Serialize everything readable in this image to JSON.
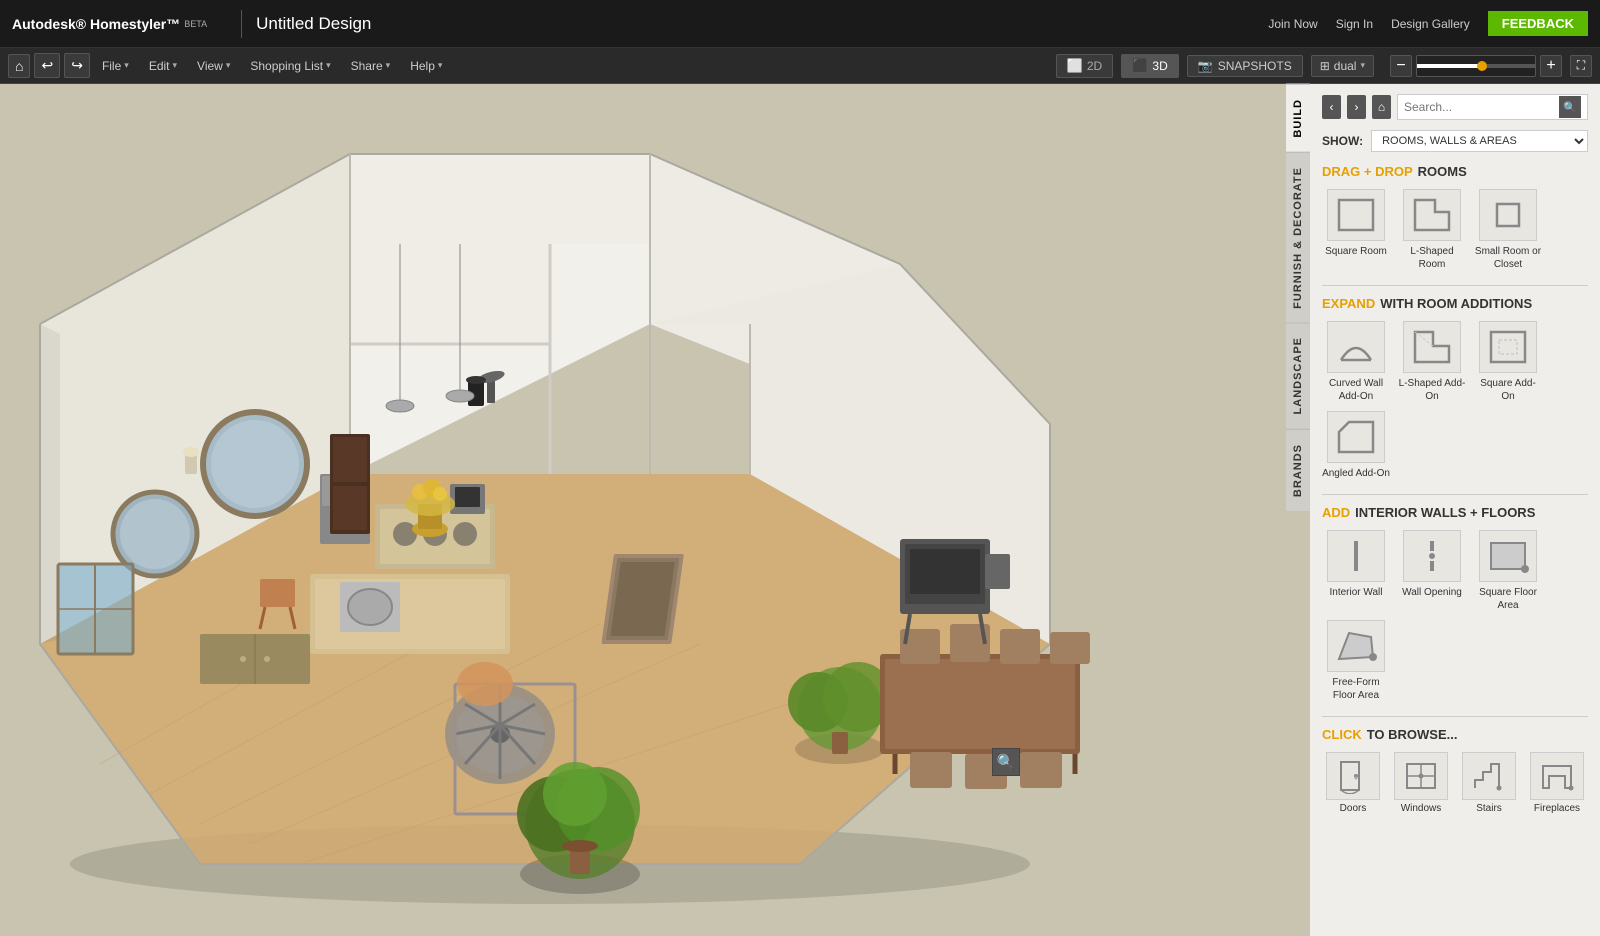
{
  "app": {
    "brand": "Autodesk® Homestyler™",
    "beta_label": "BETA",
    "title": "Untitled Design",
    "top_links": [
      "Join Now",
      "Sign In",
      "Design Gallery"
    ],
    "feedback_label": "FEEDBACK"
  },
  "menubar": {
    "file_label": "File",
    "edit_label": "Edit",
    "view_label": "View",
    "shopping_list_label": "Shopping List",
    "share_label": "Share",
    "help_label": "Help",
    "view_2d": "2D",
    "view_3d": "3D",
    "snapshots_label": "SNAPSHOTS",
    "dual_label": "dual",
    "zoom_level": "55"
  },
  "sidebar": {
    "nav_back": "‹",
    "nav_fwd": "›",
    "nav_home": "⌂",
    "search_placeholder": "Search...",
    "show_label": "SHOW:",
    "show_option": "ROOMS, WALLS & AREAS",
    "tabs": [
      "BUILD",
      "FURNISH & DECORATE",
      "LANDSCAPE",
      "BRANDS"
    ],
    "active_tab": "BUILD",
    "sections": {
      "drag_drop": {
        "prefix": "DRAG + DROP",
        "suffix": "ROOMS",
        "items": [
          {
            "label": "Square\nRoom",
            "shape": "square"
          },
          {
            "label": "L-Shaped\nRoom",
            "shape": "l-shaped"
          },
          {
            "label": "Small Room\nor Closet",
            "shape": "small-square"
          }
        ]
      },
      "expand": {
        "prefix": "EXPAND",
        "suffix": "WITH ROOM ADDITIONS",
        "items": [
          {
            "label": "Curved Wall\nAdd-On",
            "shape": "curved"
          },
          {
            "label": "L-Shaped\nAdd-On",
            "shape": "l-add"
          },
          {
            "label": "Square\nAdd-On",
            "shape": "sq-add"
          },
          {
            "label": "Angled\nAdd-On",
            "shape": "angled"
          }
        ]
      },
      "walls_floors": {
        "prefix": "ADD",
        "suffix": "INTERIOR WALLS + FLOORS",
        "items": [
          {
            "label": "Interior\nWall",
            "shape": "wall"
          },
          {
            "label": "Wall\nOpening",
            "shape": "opening"
          },
          {
            "label": "Square\nFloor Area",
            "shape": "sq-floor"
          },
          {
            "label": "Free-Form\nFloor Area",
            "shape": "ff-floor"
          }
        ]
      },
      "browse": {
        "prefix": "CLICK",
        "suffix": "TO BROWSE...",
        "items": [
          {
            "label": "Doors",
            "icon": "door"
          },
          {
            "label": "Windows",
            "icon": "window"
          },
          {
            "label": "Stairs",
            "icon": "stairs"
          },
          {
            "label": "Fireplaces",
            "icon": "fireplace"
          }
        ]
      }
    }
  },
  "nav_controls": {
    "up": "▲",
    "down": "▼",
    "left": "◄",
    "right": "►",
    "center": "✛",
    "rotate_left": "↺",
    "rotate_right": "↻"
  }
}
